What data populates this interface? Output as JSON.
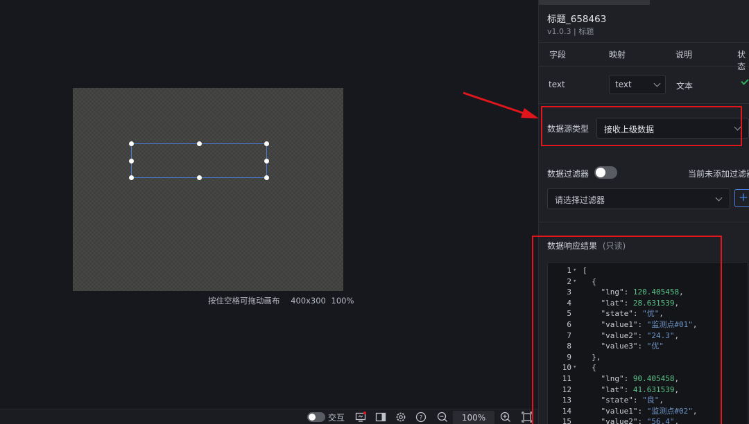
{
  "canvas": {
    "status_hint": "按住空格可拖动画布",
    "status_size": "400x300",
    "status_zoom": "100%"
  },
  "bottom_bar": {
    "interact_label": "交互",
    "zoom_value": "100%",
    "icons": [
      "toggle",
      "monitor-icon",
      "panel-toggle-icon",
      "settings-icon",
      "help-icon",
      "zoom-out-icon",
      "zoom-in-icon",
      "fit-screen-icon"
    ]
  },
  "panel": {
    "title": "标题_658463",
    "subtitle": "v1.0.3 | 标题",
    "table": {
      "headers": [
        "字段",
        "映射",
        "说明",
        "状态"
      ],
      "row": {
        "field": "text",
        "mapping": "text",
        "description": "文本",
        "status": "ok"
      }
    },
    "data_source": {
      "label": "数据源类型",
      "value": "接收上级数据"
    },
    "filter": {
      "label": "数据过滤器",
      "status_text": "当前未添加过滤器",
      "placeholder": "请选择过滤器"
    },
    "response": {
      "label": "数据响应结果",
      "readonly": "(只读)"
    }
  },
  "code_lines": [
    {
      "ln": "1",
      "fold": "▾",
      "parts": [
        [
          "k",
          "["
        ]
      ]
    },
    {
      "ln": "2",
      "fold": "▾",
      "parts": [
        [
          "k",
          "  {"
        ]
      ]
    },
    {
      "ln": "3",
      "fold": "",
      "parts": [
        [
          "k",
          "    \"lng\": "
        ],
        [
          "n",
          "120.405458"
        ],
        [
          "k",
          ","
        ]
      ]
    },
    {
      "ln": "4",
      "fold": "",
      "parts": [
        [
          "k",
          "    \"lat\": "
        ],
        [
          "n",
          "28.631539"
        ],
        [
          "k",
          ","
        ]
      ]
    },
    {
      "ln": "5",
      "fold": "",
      "parts": [
        [
          "k",
          "    \"state\": "
        ],
        [
          "s",
          "\"优\""
        ],
        [
          "k",
          ","
        ]
      ]
    },
    {
      "ln": "6",
      "fold": "",
      "parts": [
        [
          "k",
          "    \"value1\": "
        ],
        [
          "s",
          "\"监测点#01\""
        ],
        [
          "k",
          ","
        ]
      ]
    },
    {
      "ln": "7",
      "fold": "",
      "parts": [
        [
          "k",
          "    \"value2\": "
        ],
        [
          "s",
          "\"24.3\""
        ],
        [
          "k",
          ","
        ]
      ]
    },
    {
      "ln": "8",
      "fold": "",
      "parts": [
        [
          "k",
          "    \"value3\": "
        ],
        [
          "s",
          "\"优\""
        ]
      ]
    },
    {
      "ln": "9",
      "fold": "",
      "parts": [
        [
          "k",
          "  },"
        ]
      ]
    },
    {
      "ln": "10",
      "fold": "▾",
      "parts": [
        [
          "k",
          "  {"
        ]
      ]
    },
    {
      "ln": "11",
      "fold": "",
      "parts": [
        [
          "k",
          "    \"lng\": "
        ],
        [
          "n",
          "90.405458"
        ],
        [
          "k",
          ","
        ]
      ]
    },
    {
      "ln": "12",
      "fold": "",
      "parts": [
        [
          "k",
          "    \"lat\": "
        ],
        [
          "n",
          "41.631539"
        ],
        [
          "k",
          ","
        ]
      ]
    },
    {
      "ln": "13",
      "fold": "",
      "parts": [
        [
          "k",
          "    \"state\": "
        ],
        [
          "s",
          "\"良\""
        ],
        [
          "k",
          ","
        ]
      ]
    },
    {
      "ln": "14",
      "fold": "",
      "parts": [
        [
          "k",
          "    \"value1\": "
        ],
        [
          "s",
          "\"监测点#02\""
        ],
        [
          "k",
          ","
        ]
      ]
    },
    {
      "ln": "15",
      "fold": "",
      "parts": [
        [
          "k",
          "    \"value2\": "
        ],
        [
          "s",
          "\"56.4\""
        ],
        [
          "k",
          ","
        ]
      ]
    }
  ],
  "colors": {
    "accent": "#4a7fe0",
    "annotation": "#e0161c",
    "success": "#2fae5c"
  }
}
